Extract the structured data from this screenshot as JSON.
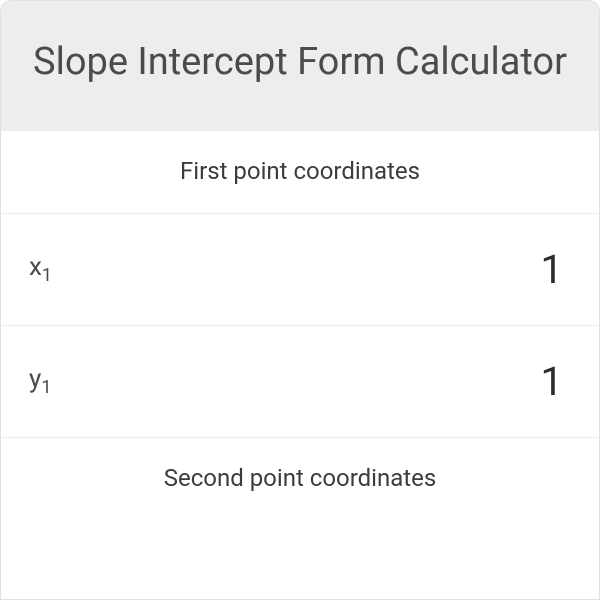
{
  "title": "Slope Intercept Form Calculator",
  "sections": {
    "first": {
      "heading": "First point coordinates",
      "x_label": "x",
      "x_sub": "1",
      "x_value": "1",
      "y_label": "y",
      "y_sub": "1",
      "y_value": "1"
    },
    "second": {
      "heading": "Second point coordinates"
    }
  }
}
